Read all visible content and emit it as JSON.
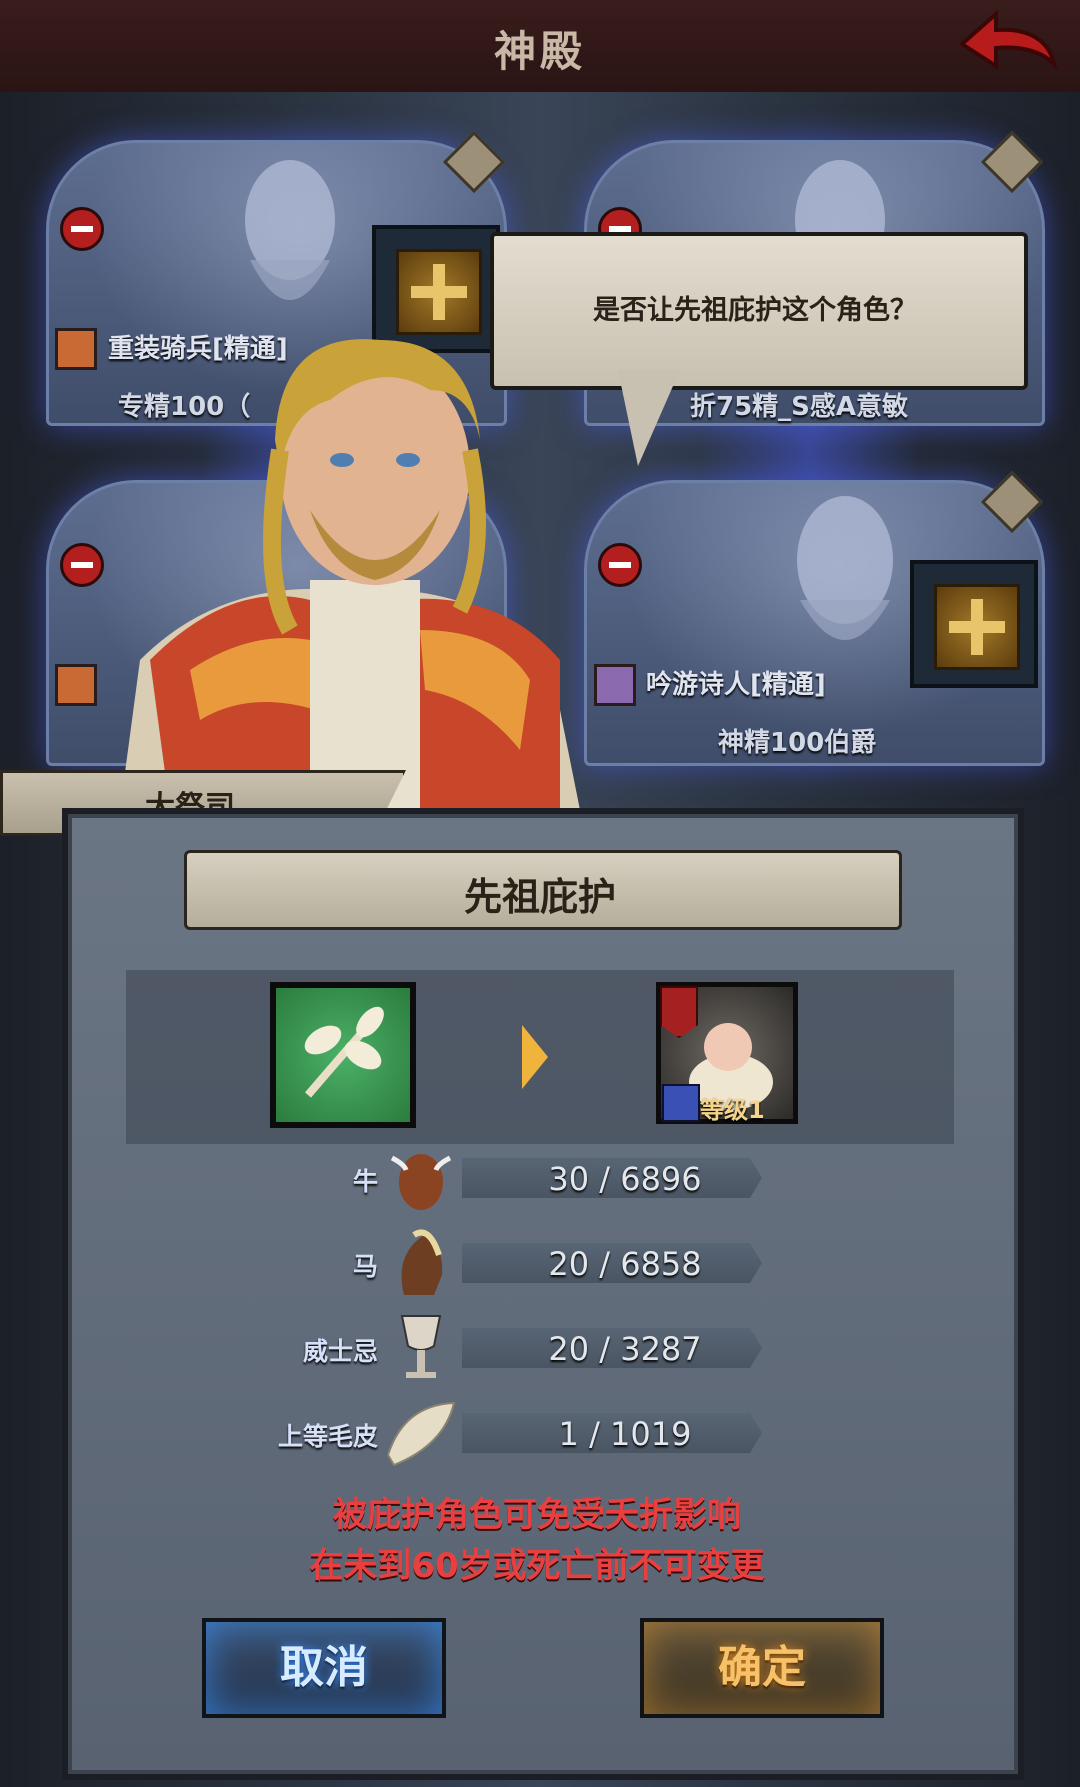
{
  "header": {
    "title": "神殿"
  },
  "cards": [
    {
      "class_name": "重装骑兵[精通]",
      "subtitle": "专精100（"
    },
    {
      "class_name": "",
      "subtitle": "折75精_S感A意敏"
    },
    {
      "class_name": "",
      "subtitle": ""
    },
    {
      "class_name": "吟游诗人[精通]",
      "subtitle": "神精100伯爵"
    }
  ],
  "dialog": {
    "question": "是否让先祖庇护这个角色？",
    "npc_name": "大祭司"
  },
  "panel": {
    "title": "先祖庇护",
    "target_level": "等级1",
    "resources": [
      {
        "name": "牛",
        "value": "30 / 6896",
        "icon": "cow-icon"
      },
      {
        "name": "马",
        "value": "20 / 6858",
        "icon": "horse-icon"
      },
      {
        "name": "威士忌",
        "value": "20 / 3287",
        "icon": "goblet-icon"
      },
      {
        "name": "上等毛皮",
        "value": "1 / 1019",
        "icon": "fur-icon"
      }
    ],
    "notes": [
      "被庇护角色可免受夭折影响",
      "在未到60岁或死亡前不可变更"
    ],
    "cancel_label": "取消",
    "confirm_label": "确定"
  },
  "colors": {
    "accent_gold": "#f0b43c",
    "warning_red": "#e84040",
    "cancel_blue": "#3a8cff"
  }
}
